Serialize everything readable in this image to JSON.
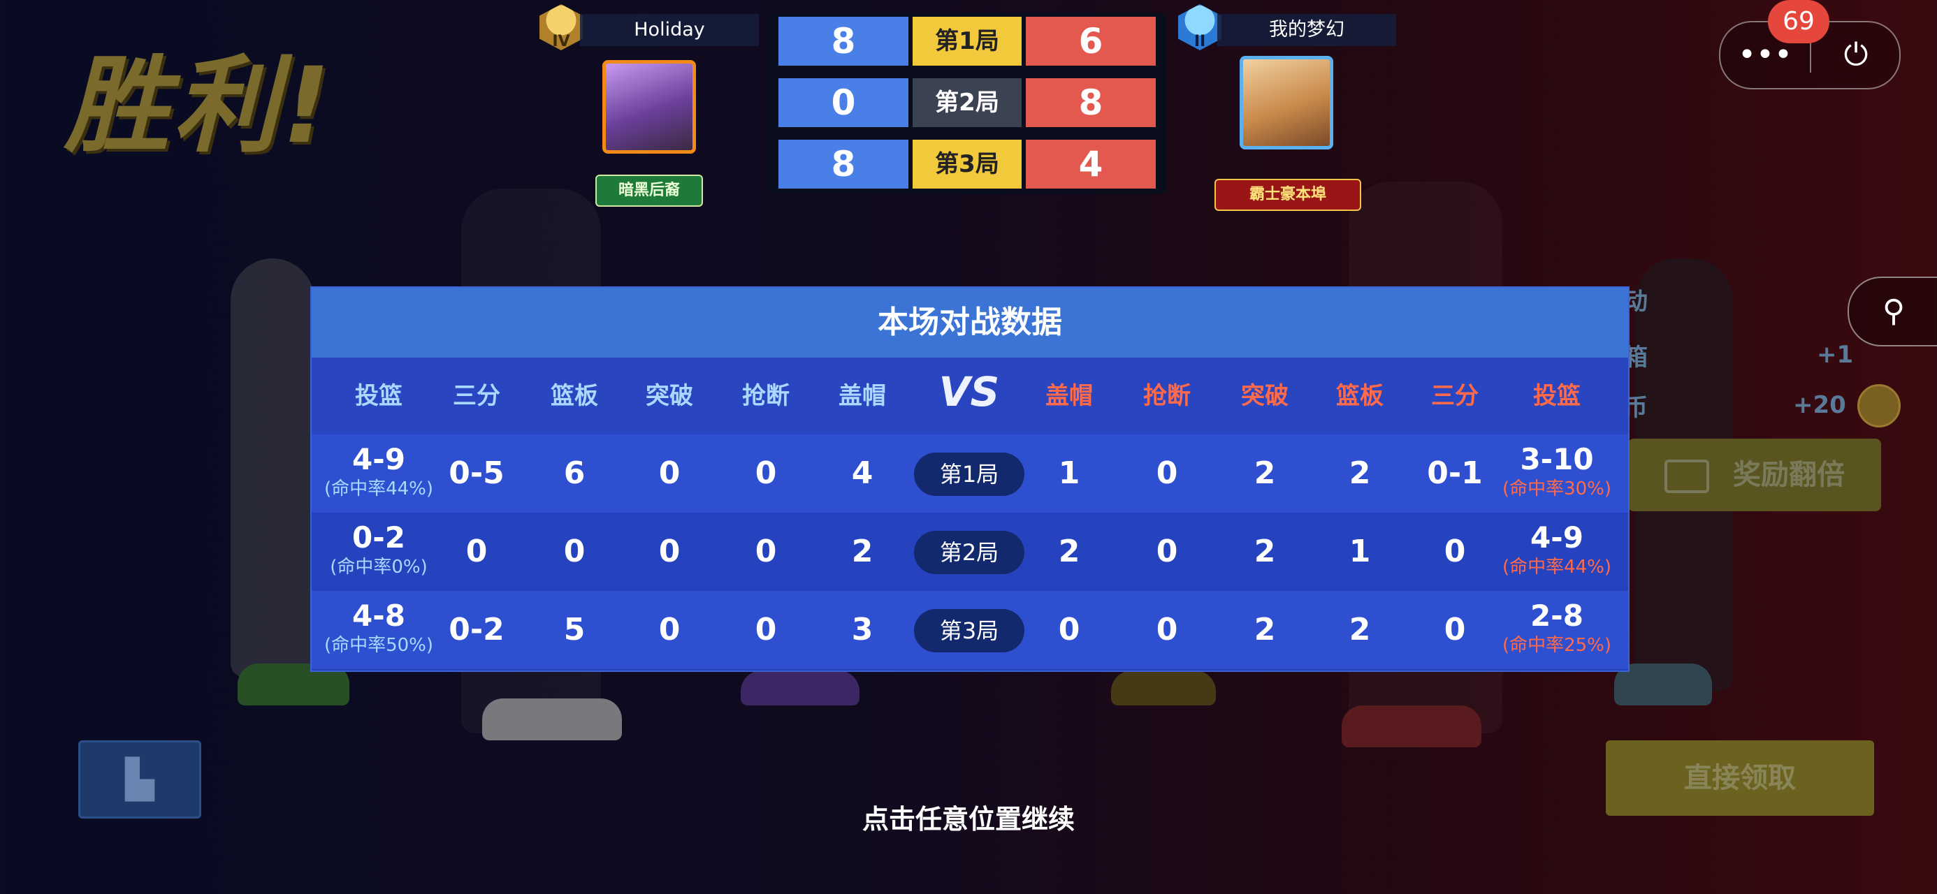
{
  "victory_text": "胜利!",
  "left_player": {
    "name": "Holiday",
    "rank": "IV",
    "badge": "暗黑后裔"
  },
  "right_player": {
    "name": "我的梦幻",
    "rank": "II",
    "badge": "霸士豪本埠"
  },
  "round_scores": [
    {
      "label": "第1局",
      "left": "8",
      "right": "6",
      "winner": "left"
    },
    {
      "label": "第2局",
      "left": "0",
      "right": "8",
      "winner": "right"
    },
    {
      "label": "第3局",
      "left": "8",
      "right": "4",
      "winner": "left"
    }
  ],
  "notification_count": "69",
  "stats_panel": {
    "title": "本场对战数据",
    "vs_label": "VS",
    "left_headers": [
      "投篮",
      "三分",
      "篮板",
      "突破",
      "抢断",
      "盖帽"
    ],
    "right_headers": [
      "盖帽",
      "抢断",
      "突破",
      "篮板",
      "三分",
      "投篮"
    ],
    "rows": [
      {
        "round": "第1局",
        "left": {
          "shot": "4-9",
          "rate": "(命中率44%)",
          "three": "0-5",
          "rebound": "6",
          "breakthrough": "0",
          "steal": "0",
          "block": "4"
        },
        "right": {
          "block": "1",
          "steal": "0",
          "breakthrough": "2",
          "rebound": "2",
          "three": "0-1",
          "shot": "3-10",
          "rate": "(命中率30%)"
        }
      },
      {
        "round": "第2局",
        "left": {
          "shot": "0-2",
          "rate": "(命中率0%)",
          "three": "0",
          "rebound": "0",
          "breakthrough": "0",
          "steal": "0",
          "block": "2"
        },
        "right": {
          "block": "2",
          "steal": "0",
          "breakthrough": "2",
          "rebound": "1",
          "three": "0",
          "shot": "4-9",
          "rate": "(命中率44%)"
        }
      },
      {
        "round": "第3局",
        "left": {
          "shot": "4-8",
          "rate": "(命中率50%)",
          "three": "0-2",
          "rebound": "5",
          "breakthrough": "0",
          "steal": "0",
          "block": "3"
        },
        "right": {
          "block": "0",
          "steal": "0",
          "breakthrough": "2",
          "rebound": "2",
          "three": "0",
          "shot": "2-8",
          "rate": "(命中率25%)"
        }
      }
    ]
  },
  "reward_side": {
    "item1_value": "+1",
    "item2_value": "+20",
    "double_reward_label": "奖励翻倍",
    "tab_label": "动",
    "partial_a": "箱",
    "partial_b": "币"
  },
  "claim_button": "直接领取",
  "continue_hint": "点击任意位置继续",
  "colors": {
    "left_blue": "#4a7fe8",
    "right_red": "#e35950",
    "round_yellow": "#f2c93a",
    "round_gray": "#3b4252"
  },
  "icons": {
    "more": "more-dots-icon",
    "power": "power-icon",
    "joystick": "joystick-icon",
    "stats": "bar-chart-icon",
    "video": "video-icon"
  }
}
